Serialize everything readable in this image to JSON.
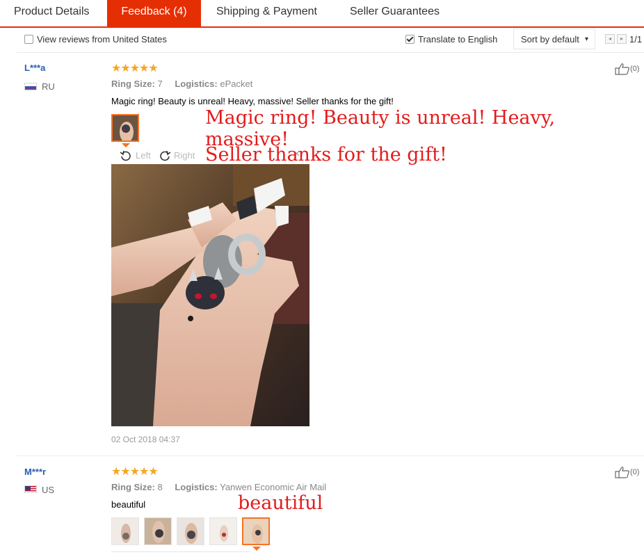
{
  "tabs": [
    {
      "label": "Product Details",
      "active": false
    },
    {
      "label": "Feedback (4)",
      "active": true
    },
    {
      "label": "Shipping & Payment",
      "active": false
    },
    {
      "label": "Seller Guarantees",
      "active": false
    }
  ],
  "filters": {
    "view_us_label": "View reviews from United States",
    "view_us_checked": false,
    "translate_label": "Translate to English",
    "translate_checked": true,
    "sort_label": "Sort by default",
    "pagination": "1/1"
  },
  "reviews": [
    {
      "user": "L***a",
      "country": "RU",
      "rating": 5,
      "stars": "★★★★★",
      "attr1_label": "Ring Size:",
      "attr1_value": "7",
      "attr2_label": "Logistics:",
      "attr2_value": "ePacket",
      "text": "Magic ring! Beauty is unreal! Heavy, massive! Seller thanks for the gift!",
      "overlay_line1": "Magic ring! Beauty is unreal! Heavy, massive!",
      "overlay_line2": "Seller thanks for the gift!",
      "rotate_left": "Left",
      "rotate_right": "Right",
      "close": "×",
      "date": "02 Oct 2018 04:37",
      "likes": "(0)"
    },
    {
      "user": "M***r",
      "country": "US",
      "rating": 5,
      "stars": "★★★★★",
      "attr1_label": "Ring Size:",
      "attr1_value": "8",
      "attr2_label": "Logistics:",
      "attr2_value": "Yanwen Economic Air Mail",
      "text": "beautiful",
      "overlay_line1": "beautiful",
      "likes": "(0)"
    }
  ],
  "icons": {
    "like": "thumbs-up-icon",
    "star": "star-icon",
    "rotate_left": "rotate-left-icon",
    "rotate_right": "rotate-right-icon"
  },
  "colors": {
    "accent": "#e62e04",
    "star": "#f5a623",
    "link": "#2a5db0",
    "overlay_text": "#e41b1b",
    "selected_thumb": "#f57224"
  }
}
